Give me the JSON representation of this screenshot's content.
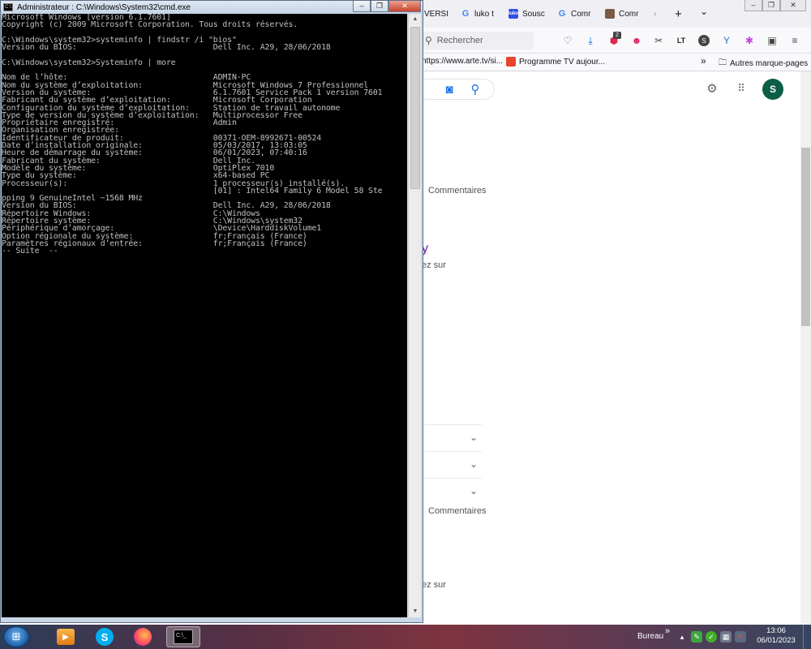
{
  "cmd": {
    "title": "Administrateur : C:\\Windows\\System32\\cmd.exe",
    "lines": [
      "Microsoft Windows [version 6.1.7601]",
      "Copyright (c) 2009 Microsoft Corporation. Tous droits réservés.",
      "",
      "C:\\Windows\\system32>systeminfo | findstr /i \"bios\"",
      "Version du BIOS:                             Dell Inc. A29, 28/06/2018",
      "",
      "C:\\Windows\\system32>Systeminfo | more",
      "",
      "Nom de l’hôte:                               ADMIN-PC",
      "Nom du système d’exploitation:               Microsoft Windows 7 Professionnel",
      "Version du système:                          6.1.7601 Service Pack 1 version 7601",
      "Fabricant du système d’exploitation:         Microsoft Corporation",
      "Configuration du système d’exploitation:     Station de travail autonome",
      "Type de version du système d’exploitation:   Multiprocessor Free",
      "Propriétaire enregistré:                     Admin",
      "Organisation enregistrée:",
      "Identificateur de produit:                   00371-OEM-8992671-00524",
      "Date d’installation originale:               05/03/2017, 13:03:05",
      "Heure de démarrage du système:               06/01/2023, 07:40:16",
      "Fabricant du système:                        Dell Inc.",
      "Modèle du système:                           OptiPlex 7010",
      "Type du système:                             x64-based PC",
      "Processeur(s):                               1 processeur(s) installé(s).",
      "                                             [01] : Intel64 Family 6 Model 58 Ste",
      "pping 9 GenuineIntel ~1568 MHz",
      "Version du BIOS:                             Dell Inc. A29, 28/06/2018",
      "Répertoire Windows:                          C:\\Windows",
      "Répertoire système:                          C:\\Windows\\system32",
      "Périphérique d’amorçage:                     \\Device\\HarddiskVolume1",
      "Option régionale du système:                 fr;Français (France)",
      "Paramètres régionaux d’entrée:               fr;Français (France)",
      "-- Suite  --"
    ]
  },
  "browser": {
    "tabs": [
      {
        "label": "VERSI",
        "icon": "tab-icon"
      },
      {
        "label": "luko t",
        "icon": "google-icon"
      },
      {
        "label": "Sousc",
        "icon": "luko-icon"
      },
      {
        "label": "Comr",
        "icon": "google-icon"
      },
      {
        "label": "Comr",
        "icon": "image-icon"
      }
    ],
    "new_tab": "+",
    "list_tabs": "⌄",
    "search_placeholder": "Rechercher",
    "bookmarks": {
      "url": "https://www.arte.tv/si...",
      "programme": "Programme TV aujour...",
      "more": "»",
      "other": "Autres marque-pages"
    },
    "ext_badge": "2",
    "page": {
      "avatar": "S",
      "commentaires_1": "Commentaires",
      "frag_y": "y",
      "frag_ez_1": "ez sur",
      "commentaires_2": "Commentaires",
      "frag_ez_2": "ez sur"
    }
  },
  "taskbar": {
    "bureau": "Bureau",
    "chevron": "»",
    "time": "13:06",
    "date": "06/01/2023",
    "skype_letter": "S"
  },
  "colors": {
    "console_bg": "#000000",
    "console_fg": "#c0c0c0",
    "avatar_bg": "#0b5d46"
  }
}
